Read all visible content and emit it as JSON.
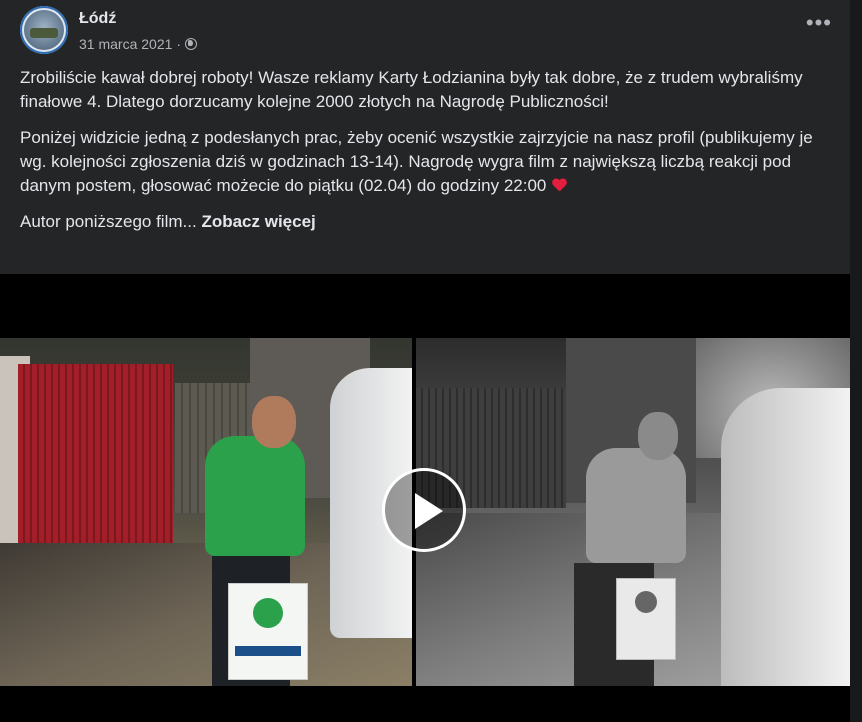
{
  "post": {
    "page_name": "Łódź",
    "date": "31 marca 2021",
    "separator": "·",
    "audience_icon": "globe-icon",
    "more_icon": "more-options-icon",
    "more_label": "•••",
    "paragraphs": [
      "Zrobiliście kawał dobrej roboty! Wasze reklamy Karty Łodzianina były tak dobre, że z trudem wybraliśmy finałowe 4. Dlatego dorzucamy kolejne 2000 złotych na Nagrodę Publiczności!",
      "Poniżej widzicie jedną z podesłanych prac, żeby ocenić wszystkie zajrzyjcie na nasz profil (publikujemy je wg. kolejności zgłoszenia dziś w godzinach 13-14). Nagrodę wygra film z największą liczbą reakcji pod danym postem, głosować możecie do piątku (02.04) do godziny 22:00"
    ],
    "heart_icon": "heart-emoji-icon",
    "truncated_text": "Autor poniższego film...",
    "see_more": "Zobacz więcej"
  },
  "video": {
    "play_icon": "play-icon"
  }
}
